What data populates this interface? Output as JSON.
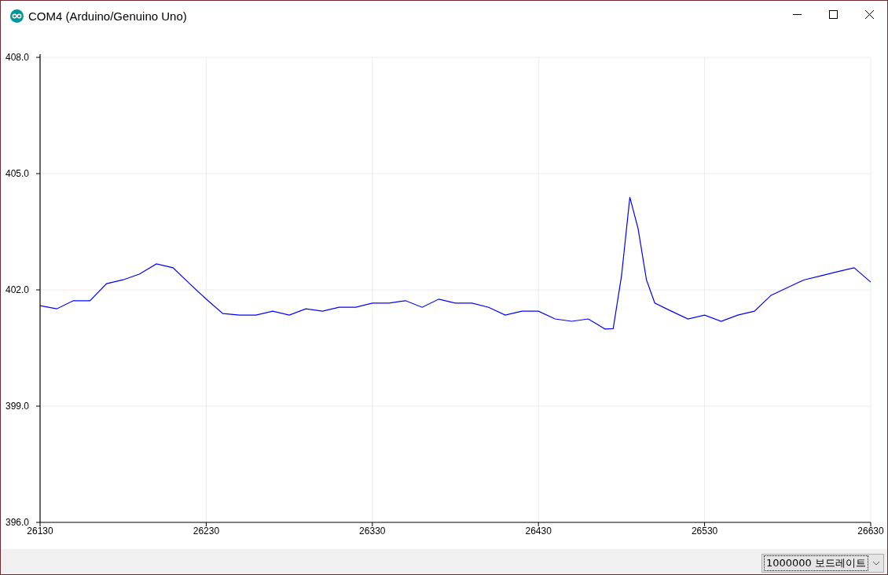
{
  "window": {
    "title": "COM4 (Arduino/Genuino Uno)"
  },
  "plot": {
    "chart_data": {
      "type": "line",
      "grid": true,
      "xlim": [
        26130,
        26630
      ],
      "ylim": [
        396,
        408
      ],
      "xticks": [
        26130,
        26230,
        26330,
        26430,
        26530,
        26630
      ],
      "yticks": [
        {
          "value": 396,
          "label": "396.0"
        },
        {
          "value": 399,
          "label": "399.0"
        },
        {
          "value": 402,
          "label": "402.0"
        },
        {
          "value": 405,
          "label": "405.0"
        },
        {
          "value": 408,
          "label": "408.0"
        }
      ],
      "x": [
        26130,
        26140,
        26150,
        26160,
        26170,
        26180,
        26190,
        26200,
        26210,
        26220,
        26230,
        26240,
        26250,
        26260,
        26270,
        26280,
        26290,
        26300,
        26310,
        26320,
        26330,
        26340,
        26350,
        26360,
        26370,
        26380,
        26390,
        26400,
        26410,
        26420,
        26430,
        26440,
        26450,
        26460,
        26470,
        26475,
        26480,
        26485,
        26490,
        26495,
        26500,
        26510,
        26520,
        26530,
        26540,
        26550,
        26560,
        26570,
        26580,
        26590,
        26600,
        26610,
        26620,
        26630
      ],
      "series": [
        {
          "color": "#0000ff",
          "values": [
            401.59,
            401.51,
            401.72,
            401.72,
            402.16,
            402.26,
            402.41,
            402.67,
            402.57,
            402.16,
            401.76,
            401.39,
            401.35,
            401.35,
            401.45,
            401.35,
            401.51,
            401.45,
            401.55,
            401.55,
            401.66,
            401.66,
            401.72,
            401.55,
            401.76,
            401.66,
            401.66,
            401.55,
            401.35,
            401.45,
            401.45,
            401.25,
            401.19,
            401.25,
            400.99,
            401.0,
            402.36,
            404.39,
            403.58,
            402.26,
            401.66,
            401.45,
            401.25,
            401.35,
            401.19,
            401.35,
            401.45,
            401.86,
            402.06,
            402.26,
            402.36,
            402.47,
            402.57,
            402.2
          ]
        }
      ]
    }
  },
  "status_bar": {
    "baud_rate": {
      "value": "1000000 보드레이트"
    }
  }
}
